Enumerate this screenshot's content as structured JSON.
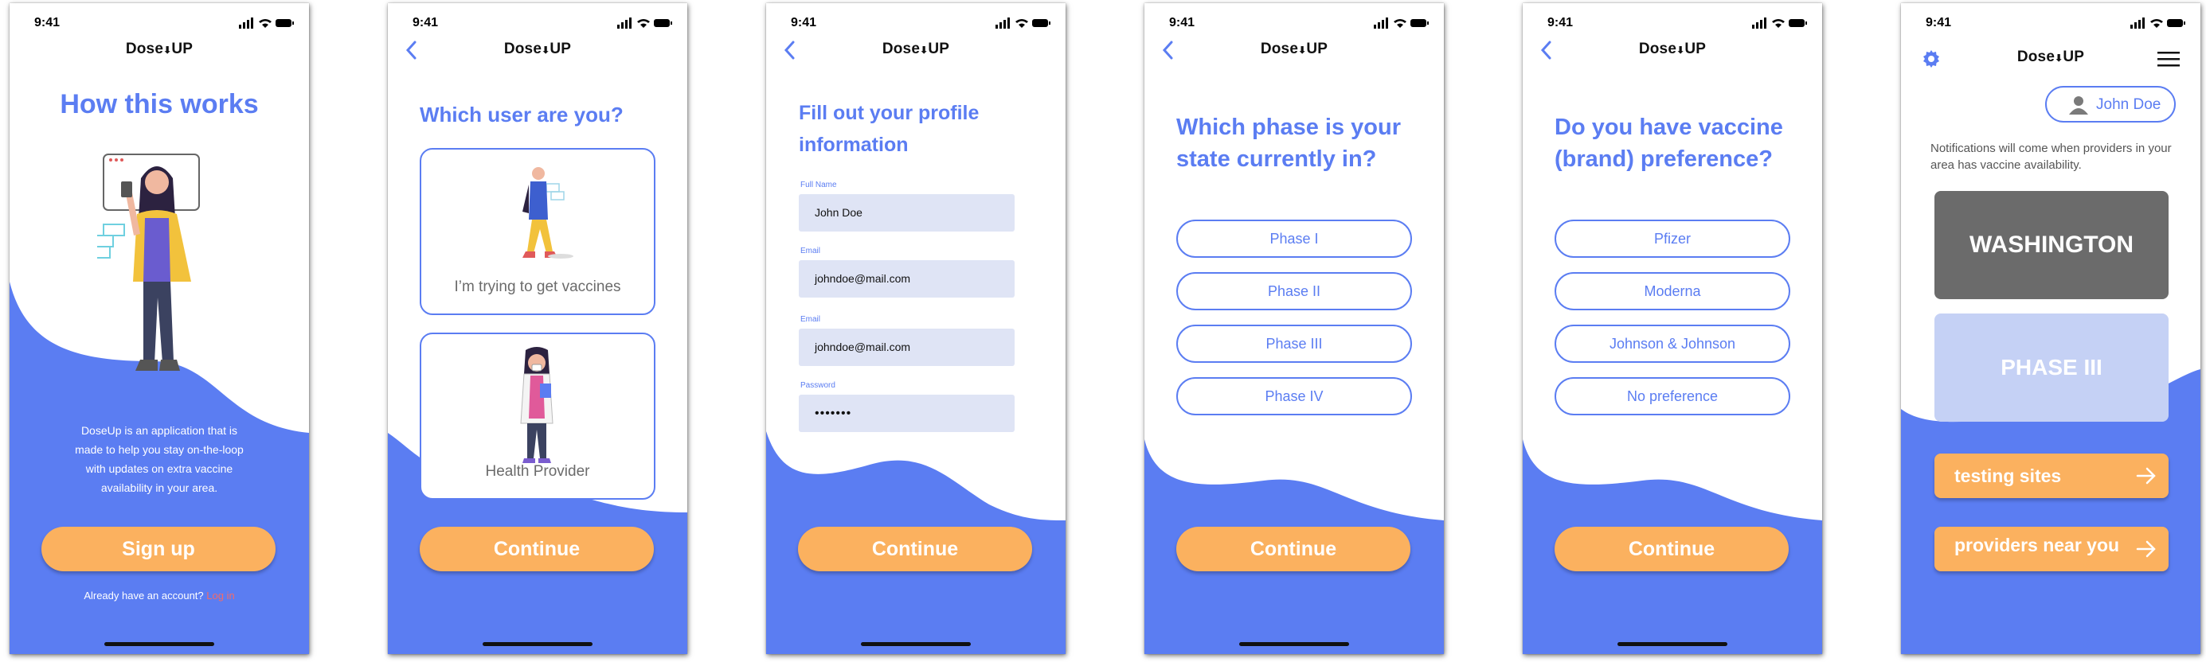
{
  "colors": {
    "primary": "#5b7df2",
    "accent": "#fbb15f",
    "link": "#f26a6a",
    "field_bg": "#dfe4f5",
    "tile_dark": "#6b6b6b",
    "tile_light": "#c5d1f5"
  },
  "status": {
    "time": "9:41"
  },
  "brand": {
    "prefix": "Dose",
    "suffix": "UP",
    "arrow_icon": "down-arrow-icon"
  },
  "screen1": {
    "title": "How this works",
    "description": "DoseUp is an application that is made to help you stay on-the-loop with updates on extra vaccine availability in your area.",
    "signup_label": "Sign up",
    "login_prompt": "Already have an account?",
    "login_link": "Log in"
  },
  "screen2": {
    "title": "Which user are you?",
    "options": [
      {
        "label": "I’m trying to get vaccines"
      },
      {
        "label": "Health Provider"
      }
    ],
    "continue_label": "Continue"
  },
  "screen3": {
    "title_line1": "Fill out your profile",
    "title_line2": "information",
    "fields": [
      {
        "label": "Full Name",
        "value": "John Doe"
      },
      {
        "label": "Email",
        "value": "johndoe@mail.com"
      },
      {
        "label": "Email",
        "value": "johndoe@mail.com"
      },
      {
        "label": "Password",
        "value": "•••••••"
      }
    ],
    "continue_label": "Continue"
  },
  "screen4": {
    "title_line1": "Which phase is your",
    "title_line2": "state currently in?",
    "options": [
      "Phase I",
      "Phase II",
      "Phase III",
      "Phase IV"
    ],
    "continue_label": "Continue"
  },
  "screen5": {
    "title_line1": "Do you have vaccine",
    "title_line2": "(brand) preference?",
    "options": [
      "Pfizer",
      "Moderna",
      "Johnson & Johnson",
      "No preference"
    ],
    "continue_label": "Continue"
  },
  "screen6": {
    "user_name": "John Doe",
    "notice": "Notifications will come when providers in your area has vaccine availability.",
    "state": "WASHINGTON",
    "phase": "PHASE III",
    "actions": [
      "testing sites",
      "providers near you"
    ]
  }
}
